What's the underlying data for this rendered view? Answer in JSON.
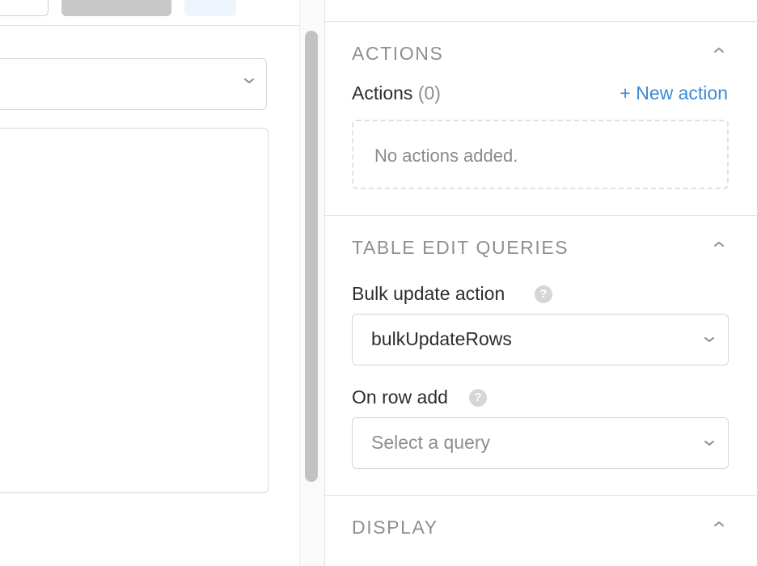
{
  "inspector": {
    "actions_section": {
      "title": "ACTIONS",
      "label": "Actions",
      "count": "(0)",
      "new_action_label": "+ New action",
      "empty_text": "No actions added."
    },
    "table_edit_queries_section": {
      "title": "TABLE EDIT QUERIES",
      "bulk_update": {
        "label": "Bulk update action",
        "help_glyph": "?",
        "value": "bulkUpdateRows"
      },
      "on_row_add": {
        "label": "On row add",
        "help_glyph": "?",
        "placeholder": "Select a query"
      }
    },
    "display_section": {
      "title": "DISPLAY"
    }
  },
  "colors": {
    "link": "#3b8ad9",
    "section_title": "#8f8f8f",
    "border": "#d6d6d6"
  },
  "icons": {
    "collapse": "chevron-up-icon",
    "dropdown": "chevron-down-icon",
    "help": "help-circle-icon"
  }
}
